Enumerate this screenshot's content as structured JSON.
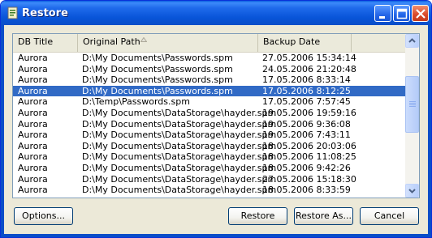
{
  "window": {
    "title": "Restore"
  },
  "list": {
    "columns": [
      "DB Title",
      "Original Path",
      "Backup Date"
    ],
    "rows": [
      [
        "Aurora",
        "D:\\My Documents\\Passwords.spm",
        "27.05.2006 15:34:14"
      ],
      [
        "Aurora",
        "D:\\My Documents\\Passwords.spm",
        "24.05.2006 21:20:48"
      ],
      [
        "Aurora",
        "D:\\My Documents\\Passwords.spm",
        "17.05.2006 8:33:14"
      ],
      [
        "Aurora",
        "D:\\My Documents\\Passwords.spm",
        "17.05.2006 8:12:25"
      ],
      [
        "Aurora",
        "D:\\Temp\\Passwords.spm",
        "17.05.2006 7:57:45"
      ],
      [
        "Aurora",
        "D:\\My Documents\\DataStorage\\hayder.spm",
        "19.05.2006 19:59:16"
      ],
      [
        "Aurora",
        "D:\\My Documents\\DataStorage\\hayder.spm",
        "19.05.2006 9:36:08"
      ],
      [
        "Aurora",
        "D:\\My Documents\\DataStorage\\hayder.spm",
        "19.05.2006 7:43:11"
      ],
      [
        "Aurora",
        "D:\\My Documents\\DataStorage\\hayder.spm",
        "18.05.2006 20:03:06"
      ],
      [
        "Aurora",
        "D:\\My Documents\\DataStorage\\hayder.spm",
        "18.05.2006 11:08:25"
      ],
      [
        "Aurora",
        "D:\\My Documents\\DataStorage\\hayder.spm",
        "18.05.2006 9:42:26"
      ],
      [
        "Aurora",
        "D:\\My Documents\\DataStorage\\hayder.spm",
        "27.05.2006 15:18:30"
      ],
      [
        "Aurora",
        "D:\\My Documents\\DataStorage\\hayder.spm",
        "18.05.2006 8:33:59"
      ]
    ],
    "selected_row_index": 3
  },
  "buttons": {
    "options": "Options...",
    "restore": "Restore",
    "restore_as": "Restore As...",
    "cancel": "Cancel"
  },
  "colors": {
    "title_bar": "#0a4ec8",
    "selection": "#316ac5",
    "dialog_bg": "#ece9d8"
  },
  "icons": {
    "app": "database-icon",
    "sort": "sort-ascending-icon",
    "minimize": "minimize-icon",
    "maximize": "maximize-icon",
    "close": "close-icon"
  }
}
